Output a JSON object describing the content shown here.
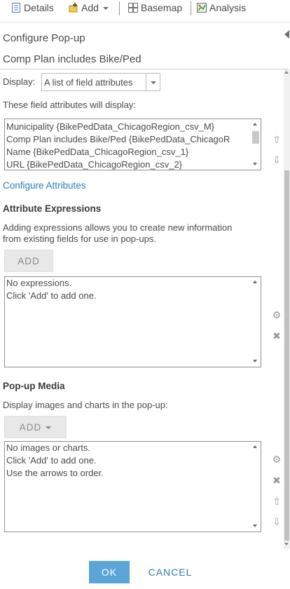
{
  "toolbar": {
    "details_label": "Details",
    "add_label": "Add",
    "basemap_label": "Basemap",
    "analysis_label": "Analysis"
  },
  "panel": {
    "title": "Configure Pop-up",
    "layer_title": "Comp Plan includes Bike/Ped"
  },
  "display": {
    "label": "Display:",
    "selected": "A list of field attributes"
  },
  "fields": {
    "heading": "These field attributes will display:",
    "items": [
      "Municipality {BikePedData_ChicagoRegion_csv_M}",
      "Comp Plan includes Bike/Ped {BikePedData_ChicagoR",
      "Name {BikePedData_ChicagoRegion_csv_1}",
      "URL {BikePedData_ChicagoRegion_csv_2}"
    ],
    "configure_link": "Configure Attributes"
  },
  "expressions": {
    "heading": "Attribute Expressions",
    "description_line1": "Adding expressions allows you to create new information",
    "description_line2": "from existing fields for use in pop-ups.",
    "add_button": "ADD",
    "empty_line1": "No expressions.",
    "empty_line2": "Click 'Add' to add one."
  },
  "media": {
    "heading": "Pop-up Media",
    "description": "Display images and charts in the pop-up:",
    "add_button": "ADD",
    "empty_line1": "No images or charts.",
    "empty_line2": "Click 'Add' to add one.",
    "empty_line3": "Use the arrows to order."
  },
  "footer": {
    "ok_label": "OK",
    "cancel_label": "CANCEL"
  },
  "colors": {
    "link": "#2c7fb8",
    "ok_button": "#5aa5d6",
    "text": "#4c4c4c"
  }
}
